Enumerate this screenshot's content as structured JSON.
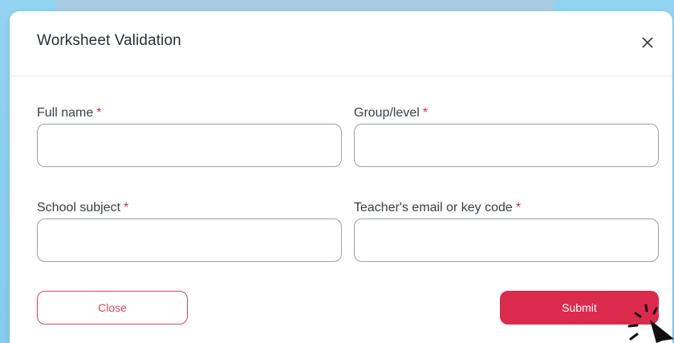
{
  "modal": {
    "title": "Worksheet Validation",
    "close_icon": "close-icon"
  },
  "form": {
    "required_marker": "*",
    "fields": [
      {
        "label": "Full name",
        "value": "",
        "required": true
      },
      {
        "label": "Group/level",
        "value": "",
        "required": true
      },
      {
        "label": "School subject",
        "value": "",
        "required": true
      },
      {
        "label": "Teacher's email or key code",
        "value": "",
        "required": true
      }
    ]
  },
  "buttons": {
    "close_label": "Close",
    "submit_label": "Submit"
  },
  "colors": {
    "accent": "#dc2a4d",
    "required": "#d5283f",
    "backdrop": "#8ccff0",
    "input_border": "#9aa1a8"
  },
  "icons": {
    "cursor": "pointer-cursor-icon"
  }
}
